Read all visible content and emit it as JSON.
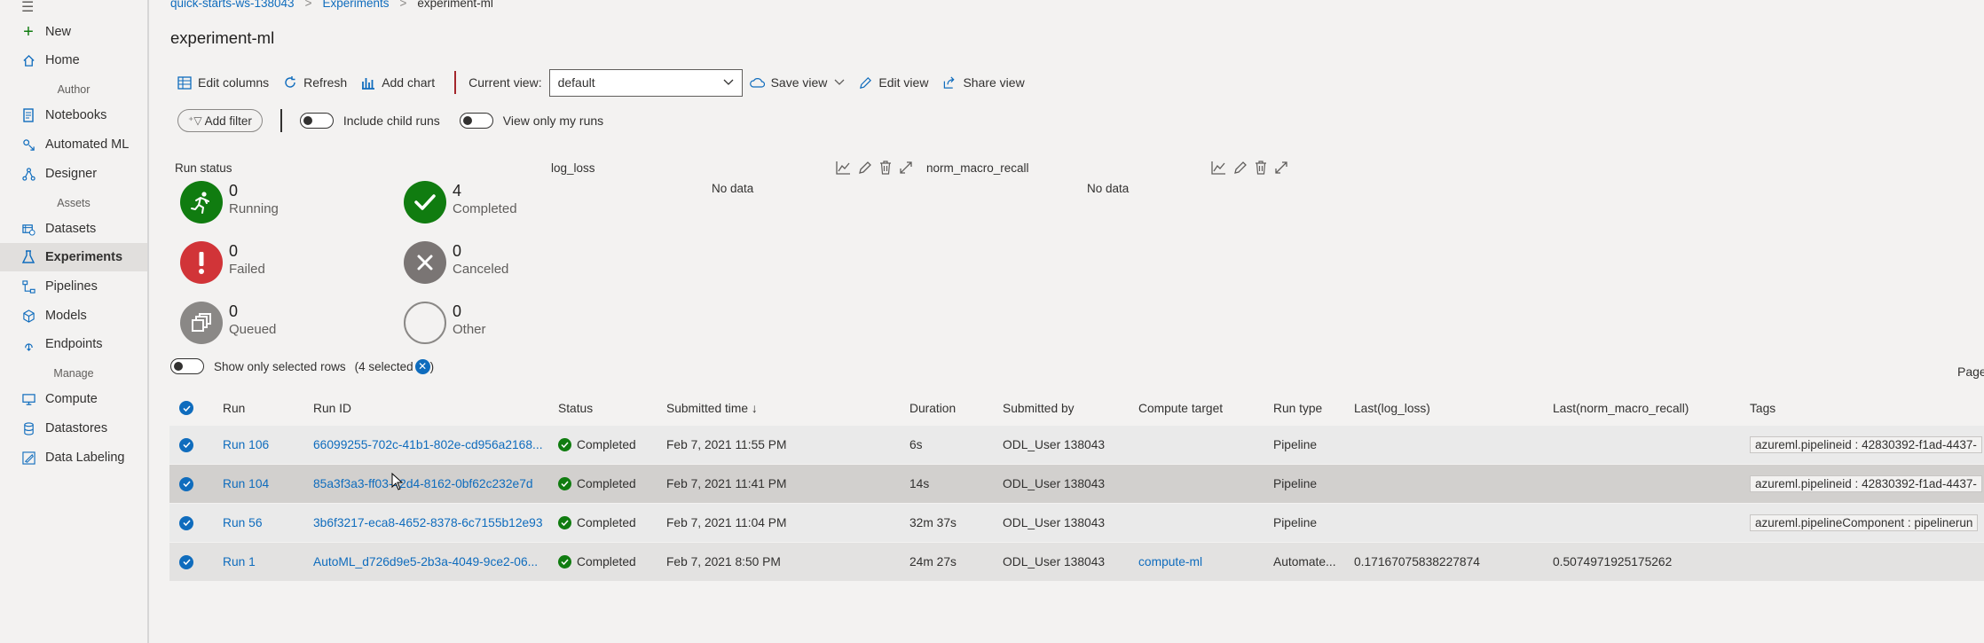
{
  "sidebar": {
    "new": "New",
    "home": "Home",
    "section_author": "Author",
    "notebooks": "Notebooks",
    "automated_ml": "Automated ML",
    "designer": "Designer",
    "section_assets": "Assets",
    "datasets": "Datasets",
    "experiments": "Experiments",
    "pipelines": "Pipelines",
    "models": "Models",
    "endpoints": "Endpoints",
    "section_manage": "Manage",
    "compute": "Compute",
    "datastores": "Datastores",
    "data_labeling": "Data Labeling"
  },
  "breadcrumb": {
    "workspace": "quick-starts-ws-138043",
    "experiments": "Experiments",
    "current": "experiment-ml"
  },
  "title": "experiment-ml",
  "toolbar": {
    "edit_columns": "Edit columns",
    "refresh": "Refresh",
    "add_chart": "Add chart",
    "current_view_label": "Current view:",
    "current_view_value": "default",
    "save_view": "Save view",
    "edit_view": "Edit view",
    "share_view": "Share view"
  },
  "filters": {
    "add_filter": "Add filter",
    "include_child_runs": "Include child runs",
    "only_my_runs": "View only my runs"
  },
  "run_status": {
    "label": "Run status",
    "running": {
      "count": "0",
      "label": "Running"
    },
    "completed": {
      "count": "4",
      "label": "Completed"
    },
    "failed": {
      "count": "0",
      "label": "Failed"
    },
    "canceled": {
      "count": "0",
      "label": "Canceled"
    },
    "queued": {
      "count": "0",
      "label": "Queued"
    },
    "other": {
      "count": "0",
      "label": "Other"
    }
  },
  "charts": [
    {
      "title": "log_loss",
      "empty": "No data"
    },
    {
      "title": "norm_macro_recall",
      "empty": "No data"
    }
  ],
  "selection": {
    "label": "Show only selected rows",
    "count": "(4 selected"
  },
  "paging": {
    "label": "Page"
  },
  "columns": {
    "run": "Run",
    "run_id": "Run ID",
    "status": "Status",
    "submitted_time": "Submitted time ↓",
    "duration": "Duration",
    "submitted_by": "Submitted by",
    "compute_target": "Compute target",
    "run_type": "Run type",
    "last_log_loss": "Last(log_loss)",
    "last_recall": "Last(norm_macro_recall)",
    "tags": "Tags"
  },
  "rows": [
    {
      "run": "Run 106",
      "run_id": "66099255-702c-41b1-802e-cd956a2168...",
      "status": "Completed",
      "submitted": "Feb 7, 2021 11:55 PM",
      "duration": "6s",
      "by": "ODL_User 138043",
      "compute": "",
      "type": "Pipeline",
      "log_loss": "",
      "recall": "",
      "tag": "azureml.pipelineid : 42830392-f1ad-4437-"
    },
    {
      "run": "Run 104",
      "run_id": "85a3f3a3-ff03-42d4-8162-0bf62c232e7d",
      "status": "Completed",
      "submitted": "Feb 7, 2021 11:41 PM",
      "duration": "14s",
      "by": "ODL_User 138043",
      "compute": "",
      "type": "Pipeline",
      "log_loss": "",
      "recall": "",
      "tag": "azureml.pipelineid : 42830392-f1ad-4437-"
    },
    {
      "run": "Run 56",
      "run_id": "3b6f3217-eca8-4652-8378-6c7155b12e93",
      "status": "Completed",
      "submitted": "Feb 7, 2021 11:04 PM",
      "duration": "32m 37s",
      "by": "ODL_User 138043",
      "compute": "",
      "type": "Pipeline",
      "log_loss": "",
      "recall": "",
      "tag": "azureml.pipelineComponent : pipelinerun"
    },
    {
      "run": "Run 1",
      "run_id": "AutoML_d726d9e5-2b3a-4049-9ce2-06...",
      "status": "Completed",
      "submitted": "Feb 7, 2021 8:50 PM",
      "duration": "24m 27s",
      "by": "ODL_User 138043",
      "compute": "compute-ml",
      "type": "Automate...",
      "log_loss": "0.17167075838227874",
      "recall": "0.5074971925175262",
      "tag": ""
    }
  ]
}
